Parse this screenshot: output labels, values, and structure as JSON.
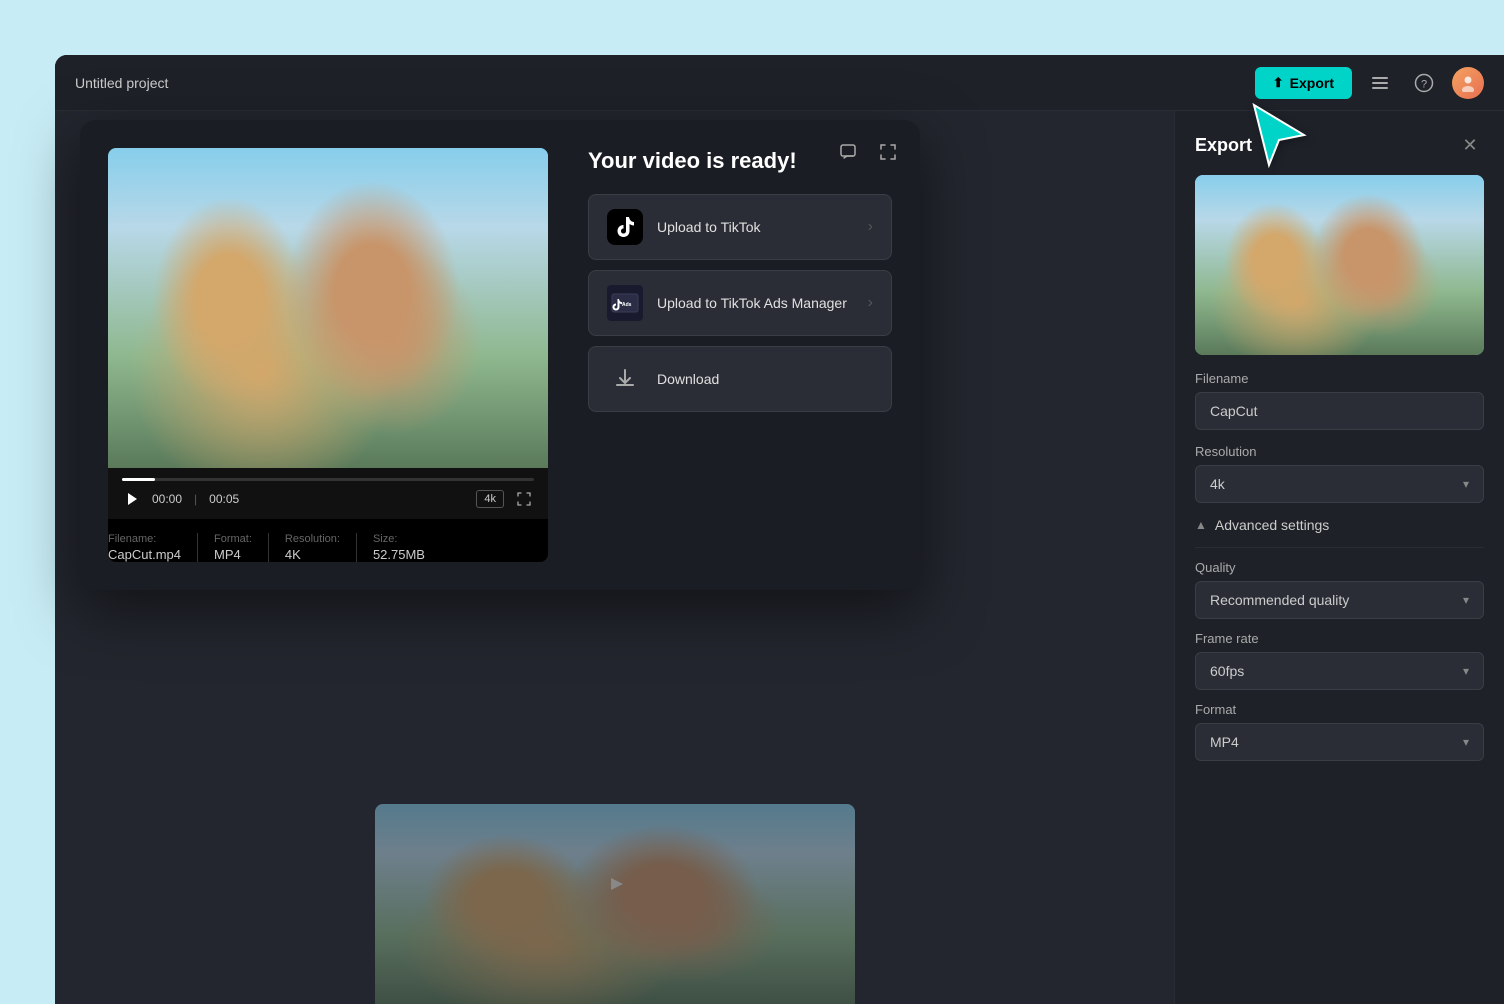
{
  "app": {
    "title": "Untitled project",
    "bg_color": "#c8ecf5"
  },
  "header": {
    "title": "Untitled project",
    "export_btn_label": "Export",
    "export_icon": "▲",
    "stack_icon": "≡",
    "help_icon": "?",
    "avatar_icon": "👤"
  },
  "canvas": {
    "play_icon": "▷"
  },
  "video_modal": {
    "title": "Your video is ready!",
    "comment_icon": "💬",
    "fullscreen_icon": "⛶",
    "actions": [
      {
        "id": "upload-tiktok",
        "label": "Upload to TikTok",
        "icon": "tiktok",
        "has_chevron": true
      },
      {
        "id": "upload-tiktok-ads",
        "label": "Upload to TikTok Ads Manager",
        "icon": "tiktok-ads",
        "has_chevron": true
      },
      {
        "id": "download",
        "label": "Download",
        "icon": "download",
        "has_chevron": false
      }
    ],
    "player": {
      "current_time": "00:00",
      "total_time": "00:05",
      "quality": "4k",
      "progress_percent": 8
    },
    "meta": {
      "filename_label": "Filename:",
      "filename_value": "CapCut.mp4",
      "format_label": "Format:",
      "format_value": "MP4",
      "resolution_label": "Resolution:",
      "resolution_value": "4K",
      "size_label": "Size:",
      "size_value": "52.75MB"
    }
  },
  "export_panel": {
    "title": "Export",
    "close_icon": "✕",
    "filename_label": "Filename",
    "filename_value": "CapCut",
    "resolution_label": "Resolution",
    "resolution_value": "4k",
    "resolution_chevron": "▾",
    "advanced_settings_label": "Advanced settings",
    "advanced_toggle_icon": "▲",
    "quality_label": "Quality",
    "quality_value": "Recommended quality",
    "quality_chevron": "▾",
    "framerate_label": "Frame rate",
    "framerate_value": "60fps",
    "framerate_chevron": "▾",
    "format_label": "Format",
    "format_value": "MP4",
    "format_chevron": "▾"
  }
}
